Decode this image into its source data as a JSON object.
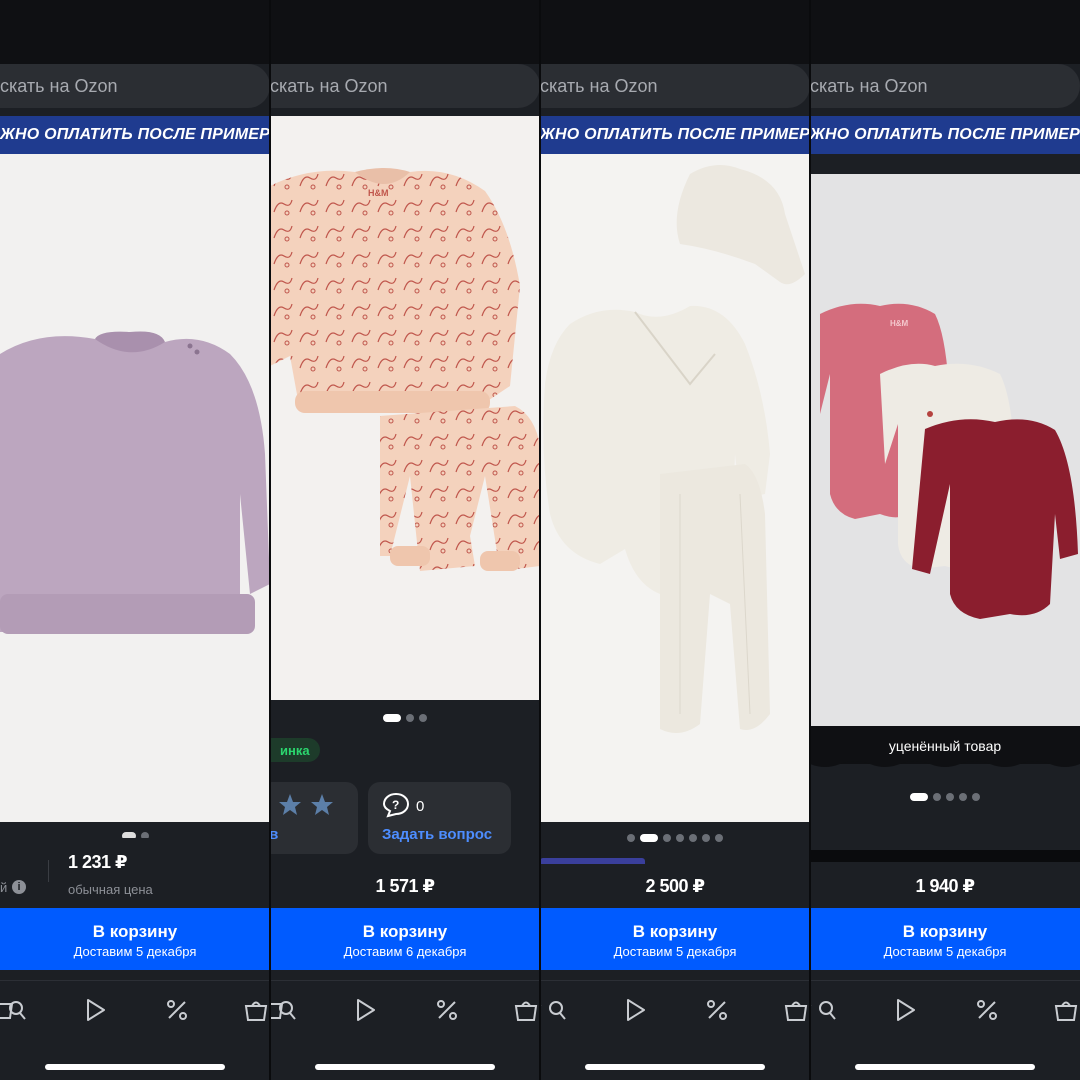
{
  "search": {
    "placeholder": "скать на Ozon"
  },
  "banner": {
    "text": "ЖНО ОПЛАТИТЬ ПОСЛЕ ПРИМЕРКИ"
  },
  "panels": [
    {
      "price": "1 231 ₽",
      "price_caption": "обычная цена",
      "left_fragment": "й",
      "cart_label": "В корзину",
      "delivery": "Доставим 5 декабря"
    },
    {
      "price": "1 571 ₽",
      "badge": "инка",
      "reviews_fragment": "ов",
      "questions_count": "0",
      "ask_label": "Задать вопрос",
      "cart_label": "В корзину",
      "delivery": "Доставим 6 декабря"
    },
    {
      "price": "2 500 ₽",
      "cart_label": "В корзину",
      "delivery": "Доставим 5 декабря"
    },
    {
      "price": "1 940 ₽",
      "discount_label": "уценённый товар",
      "cart_label": "В корзину",
      "delivery": "Доставим 5 декабря"
    }
  ],
  "colors": {
    "cart_button": "#005bff",
    "banner": "#1f3b8f",
    "background": "#1c1f24",
    "badge_text": "#2bd66e",
    "ask_link": "#4d8dff"
  },
  "icons": [
    "cart-search-icon",
    "play-icon",
    "percent-icon",
    "bag-icon",
    "question-bubble-icon",
    "info-icon",
    "star-icon"
  ]
}
